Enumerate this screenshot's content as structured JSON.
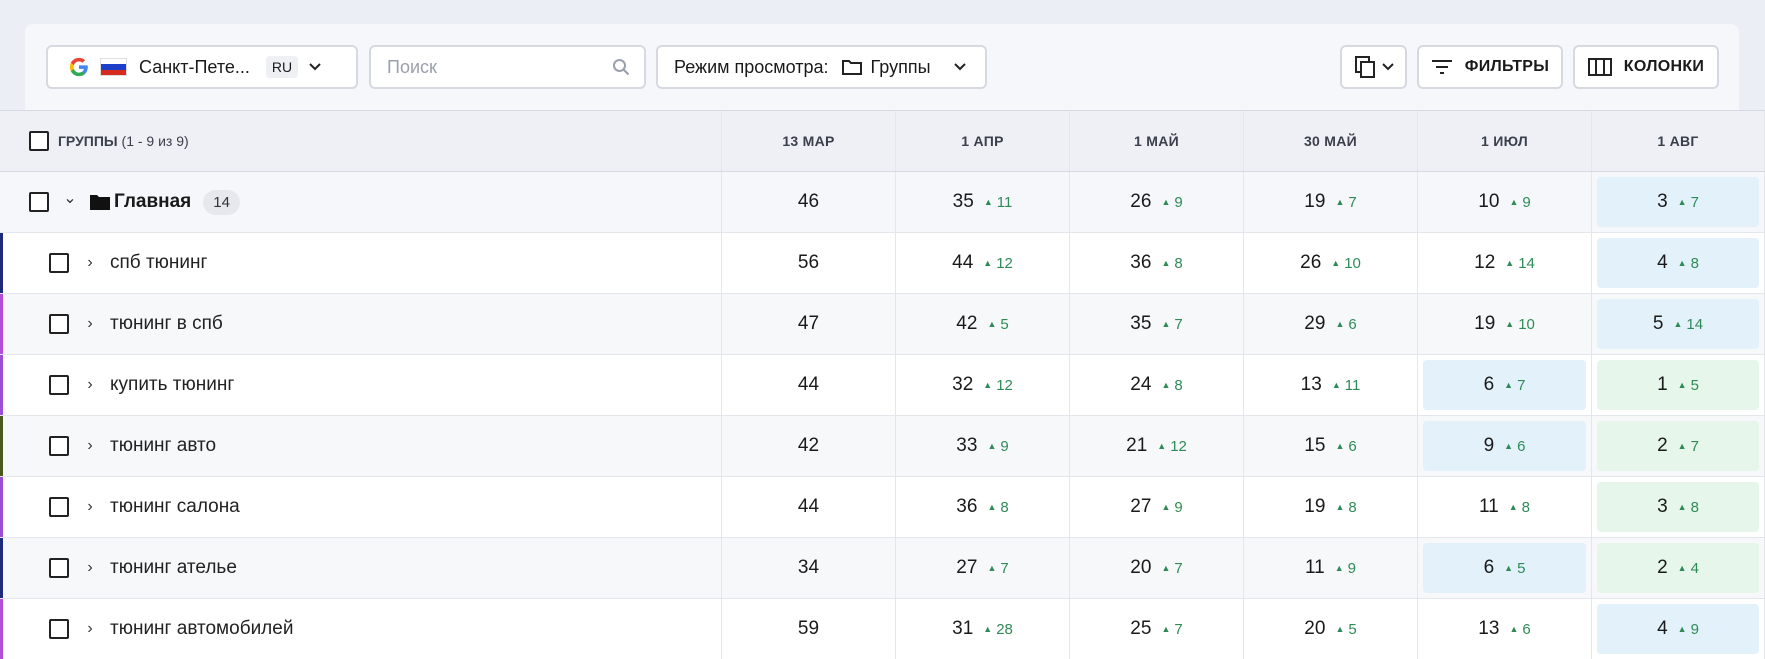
{
  "toolbar": {
    "region_name": "Санкт-Пете...",
    "region_lang": "RU",
    "search_placeholder": "Поиск",
    "view_mode_label": "Режим просмотра:",
    "view_mode_value": "Группы",
    "filters_label": "ФИЛЬТРЫ",
    "columns_label": "КОЛОНКИ"
  },
  "table": {
    "header_groups": "ГРУППЫ",
    "header_range": "(1 - 9 из 9)",
    "columns": [
      "13 МАР",
      "1 АПР",
      "1 МАЙ",
      "30 МАЙ",
      "1 ИЮЛ",
      "1 АВГ"
    ],
    "rows": [
      {
        "name": "Главная",
        "badge": "14",
        "type": "group",
        "cells": [
          {
            "v": "46"
          },
          {
            "v": "35",
            "d": "11"
          },
          {
            "v": "26",
            "d": "9"
          },
          {
            "v": "19",
            "d": "7"
          },
          {
            "v": "10",
            "d": "9"
          },
          {
            "v": "3",
            "d": "7",
            "hl": "blue"
          }
        ]
      },
      {
        "name": "спб тюнинг",
        "accent": "#1f2b7a",
        "cells": [
          {
            "v": "56"
          },
          {
            "v": "44",
            "d": "12"
          },
          {
            "v": "36",
            "d": "8"
          },
          {
            "v": "26",
            "d": "10"
          },
          {
            "v": "12",
            "d": "14"
          },
          {
            "v": "4",
            "d": "8",
            "hl": "blue"
          }
        ]
      },
      {
        "name": "тюнинг в спб",
        "accent": "#b24fd6",
        "cells": [
          {
            "v": "47"
          },
          {
            "v": "42",
            "d": "5"
          },
          {
            "v": "35",
            "d": "7"
          },
          {
            "v": "29",
            "d": "6"
          },
          {
            "v": "19",
            "d": "10"
          },
          {
            "v": "5",
            "d": "14",
            "hl": "blue"
          }
        ]
      },
      {
        "name": "купить тюнинг",
        "accent": "#9b4fd6",
        "cells": [
          {
            "v": "44"
          },
          {
            "v": "32",
            "d": "12"
          },
          {
            "v": "24",
            "d": "8"
          },
          {
            "v": "13",
            "d": "11"
          },
          {
            "v": "6",
            "d": "7",
            "hl": "blue"
          },
          {
            "v": "1",
            "d": "5",
            "hl": "green"
          }
        ]
      },
      {
        "name": "тюнинг авто",
        "accent": "#4a5a1f",
        "cells": [
          {
            "v": "42"
          },
          {
            "v": "33",
            "d": "9"
          },
          {
            "v": "21",
            "d": "12"
          },
          {
            "v": "15",
            "d": "6"
          },
          {
            "v": "9",
            "d": "6",
            "hl": "blue"
          },
          {
            "v": "2",
            "d": "7",
            "hl": "green"
          }
        ]
      },
      {
        "name": "тюнинг салона",
        "accent": "#9b4fd6",
        "cells": [
          {
            "v": "44"
          },
          {
            "v": "36",
            "d": "8"
          },
          {
            "v": "27",
            "d": "9"
          },
          {
            "v": "19",
            "d": "8"
          },
          {
            "v": "11",
            "d": "8"
          },
          {
            "v": "3",
            "d": "8",
            "hl": "green"
          }
        ]
      },
      {
        "name": "тюнинг ателье",
        "accent": "#1f2b7a",
        "cells": [
          {
            "v": "34"
          },
          {
            "v": "27",
            "d": "7"
          },
          {
            "v": "20",
            "d": "7"
          },
          {
            "v": "11",
            "d": "9"
          },
          {
            "v": "6",
            "d": "5",
            "hl": "blue"
          },
          {
            "v": "2",
            "d": "4",
            "hl": "green"
          }
        ]
      },
      {
        "name": "тюнинг автомобилей",
        "accent": "#b24fd6",
        "cells": [
          {
            "v": "59"
          },
          {
            "v": "31",
            "d": "28"
          },
          {
            "v": "25",
            "d": "7"
          },
          {
            "v": "20",
            "d": "5"
          },
          {
            "v": "13",
            "d": "6"
          },
          {
            "v": "4",
            "d": "9",
            "hl": "blue"
          }
        ]
      }
    ]
  }
}
